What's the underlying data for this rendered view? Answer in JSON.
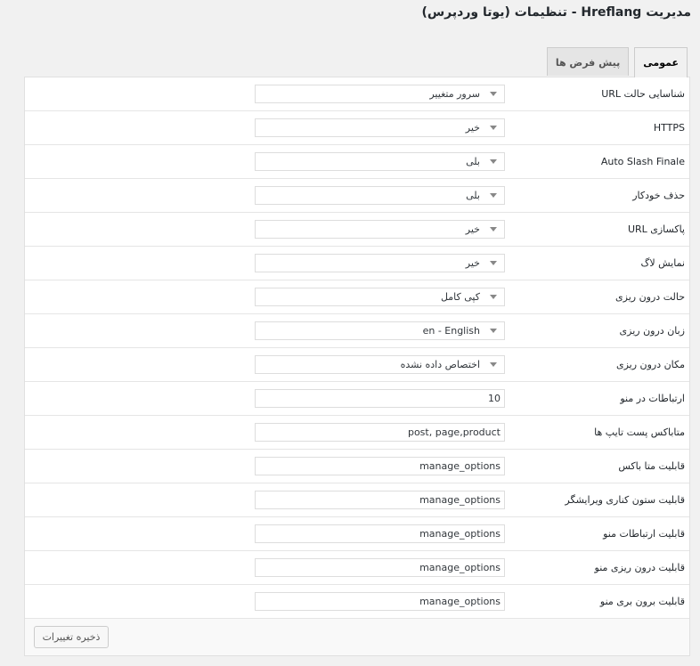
{
  "page": {
    "title": "مدیریت Hreflang - تنظیمات (یوتا وردپرس)"
  },
  "tabs": [
    {
      "label": "عمومی",
      "active": true
    },
    {
      "label": "پیش فرض ها",
      "active": false
    }
  ],
  "settings": [
    {
      "label": "شناسایی حالت URL",
      "type": "select",
      "value": "سرور متغییر"
    },
    {
      "label": "HTTPS",
      "type": "select",
      "value": "خیر"
    },
    {
      "label": "Auto Slash Finale",
      "type": "select",
      "value": "بلی"
    },
    {
      "label": "حذف خودکار",
      "type": "select",
      "value": "بلی"
    },
    {
      "label": "پاکسازی URL",
      "type": "select",
      "value": "خیر"
    },
    {
      "label": "نمایش لاگ",
      "type": "select",
      "value": "خیر"
    },
    {
      "label": "حالت درون ریزی",
      "type": "select",
      "value": "کپی کامل"
    },
    {
      "label": "زبان درون ریزی",
      "type": "select",
      "value": "en - English"
    },
    {
      "label": "مکان درون ریزی",
      "type": "select",
      "value": "اختصاص داده نشده"
    },
    {
      "label": "ارتباطات در منو",
      "type": "text",
      "value": "10"
    },
    {
      "label": "متاباکس پست تایپ ها",
      "type": "text",
      "value": "post, page,product"
    },
    {
      "label": "قابلیت متا باکس",
      "type": "text",
      "value": "manage_options"
    },
    {
      "label": "قابلیت ستون کناری ویرایشگر",
      "type": "text",
      "value": "manage_options"
    },
    {
      "label": "قابلیت ارتباطات منو",
      "type": "text",
      "value": "manage_options"
    },
    {
      "label": "قابلیت درون ریزی منو",
      "type": "text",
      "value": "manage_options"
    },
    {
      "label": "قابلیت برون بری منو",
      "type": "text",
      "value": "manage_options"
    }
  ],
  "footer": {
    "save_label": "ذخیره تغییرات"
  }
}
